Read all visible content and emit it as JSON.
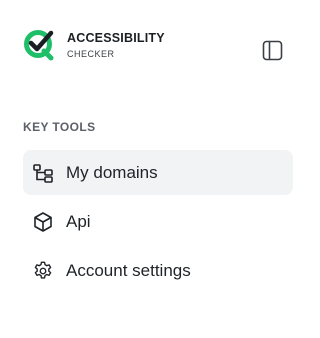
{
  "brand": {
    "title": "ACCESSIBILITY",
    "subtitle": "CHECKER",
    "colors": {
      "accent": "#1fbf6a",
      "mark": "#1b1f24"
    }
  },
  "header": {
    "collapse_icon": "sidebar-panel-icon"
  },
  "sidebar": {
    "section_label": "KEY TOOLS",
    "items": [
      {
        "label": "My domains",
        "icon": "sitemap-icon",
        "active": true
      },
      {
        "label": "Api",
        "icon": "cube-icon",
        "active": false
      },
      {
        "label": "Account settings",
        "icon": "gear-icon",
        "active": false
      }
    ]
  }
}
